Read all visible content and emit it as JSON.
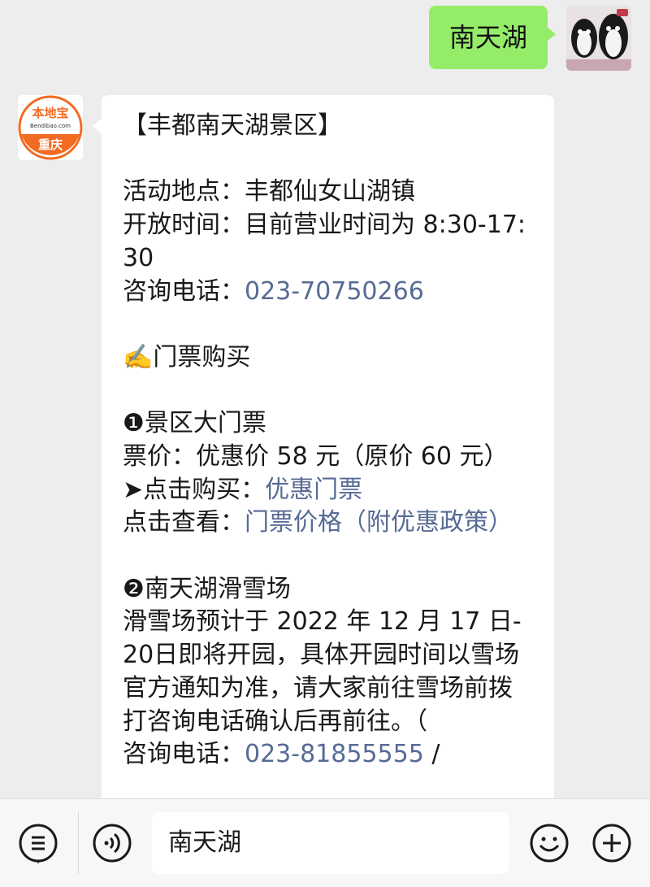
{
  "outgoing": {
    "text": "南天湖"
  },
  "bot": {
    "logo_text_top": "本地宝",
    "logo_text_url": "Bendibao.com",
    "logo_text_bottom": "重庆",
    "brand_color": "#f26b22"
  },
  "message": {
    "title": "【丰都南天湖景区】",
    "location": "活动地点：丰都仙女山湖镇",
    "hours": "开放时间：目前营业时间为 8:30-17:30",
    "phone_label": "咨询电话：",
    "phone": "023-70750266",
    "ticket_heading_icon": "✍️",
    "ticket_heading": "门票购买",
    "item1_icon": "❶",
    "item1_title": "景区大门票",
    "item1_price": "票价：优惠价 58 元（原价 60 元）",
    "buy_prefix": "➤点击购买：",
    "buy_link": "优惠门票",
    "view_prefix": "点击查看：",
    "view_link": "门票价格（附优惠政策）",
    "item2_icon": "❷",
    "item2_title": "南天湖滑雪场",
    "item2_desc": "滑雪场预计于 2022 年 12 月 17 日-20日即将开园，具体开园时间以雪场官方通知为准，请大家前往雪场前拨打咨询电话确认后再前往。（",
    "phone2_label": "咨询电话：",
    "phone2": "023-81855555",
    "phone2_suffix": " /"
  },
  "input_bar": {
    "value": "南天湖",
    "left_icon": "menu-list-icon",
    "voice_icon": "voice-icon",
    "emoji_icon": "emoji-icon",
    "plus_icon": "plus-icon"
  },
  "colors": {
    "background": "#ededed",
    "outgoing_bubble": "#95ec69",
    "link": "#576b95"
  }
}
